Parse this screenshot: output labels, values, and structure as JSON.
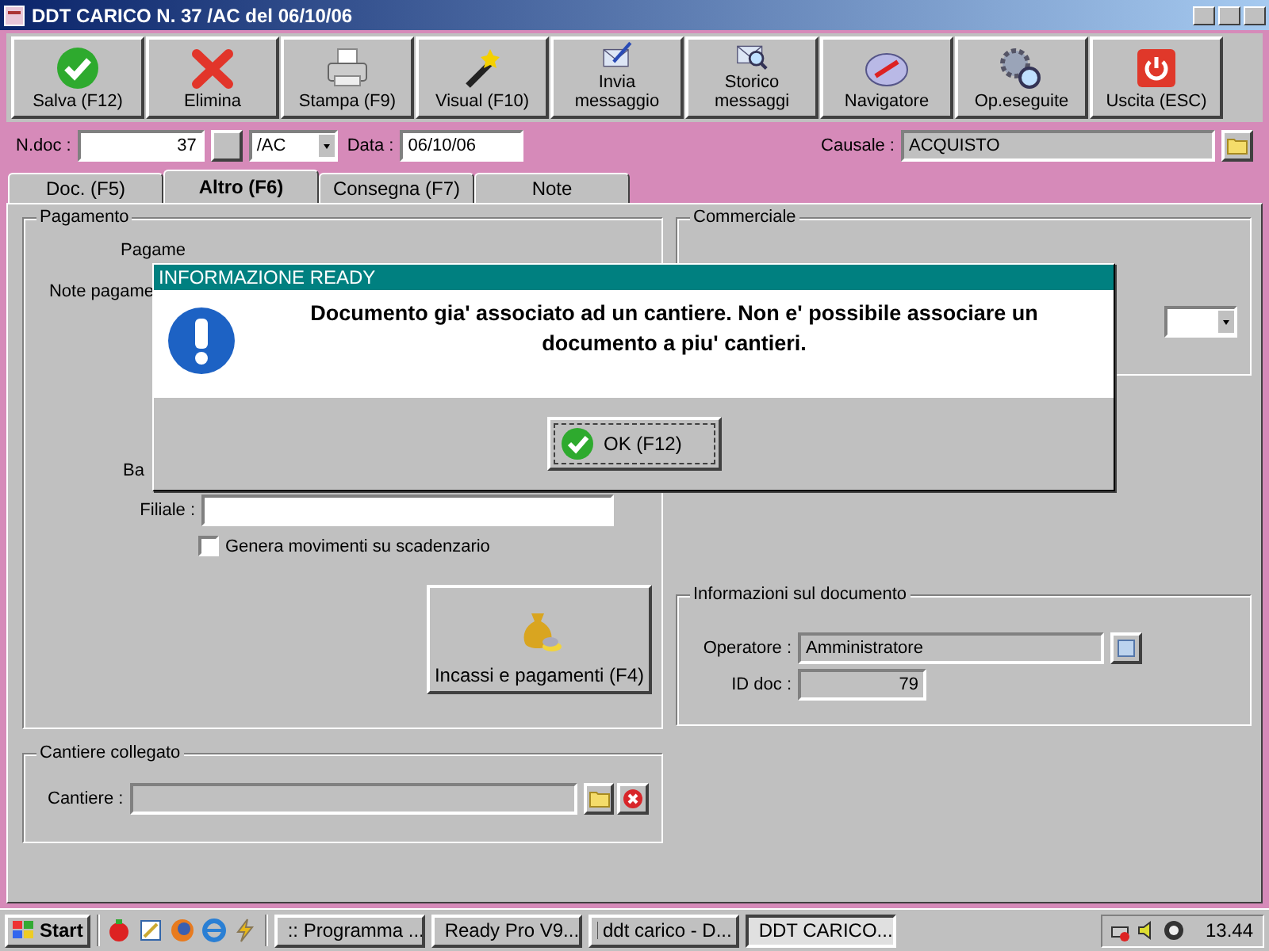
{
  "window": {
    "title": "DDT CARICO N. 37 /AC del 06/10/06"
  },
  "toolbar": [
    {
      "label": "Salva (F12)"
    },
    {
      "label": "Elimina"
    },
    {
      "label": "Stampa (F9)"
    },
    {
      "label": "Visual (F10)"
    },
    {
      "label": "Invia\nmessaggio"
    },
    {
      "label": "Storico\nmessaggi"
    },
    {
      "label": "Navigatore"
    },
    {
      "label": "Op.eseguite"
    },
    {
      "label": "Uscita (ESC)"
    }
  ],
  "header": {
    "ndoc_label": "N.doc :",
    "ndoc_value": "37",
    "series_value": "/AC",
    "data_label": "Data :",
    "data_value": "06/10/06",
    "causale_label": "Causale :",
    "causale_value": "ACQUISTO"
  },
  "tabs": [
    {
      "label": "Doc. (F5)",
      "selected": false
    },
    {
      "label": "Altro (F6)",
      "selected": true
    },
    {
      "label": "Consegna (F7)",
      "selected": false
    },
    {
      "label": "Note",
      "selected": false
    }
  ],
  "pagamento": {
    "title": "Pagamento",
    "pagamento_label": "Pagame",
    "note_label": "Note pagame",
    "banca_label": "Ba",
    "filiale_label": "Filiale :",
    "checkbox": {
      "label": "Genera movimenti su scadenzario",
      "checked": false
    },
    "incassi_button": "Incassi e pagamenti (F4)"
  },
  "cantiere": {
    "title": "Cantiere collegato",
    "label": "Cantiere :"
  },
  "commerciale": {
    "title": "Commerciale"
  },
  "informazioni": {
    "title": "Informazioni sul documento",
    "operatore_label": "Operatore :",
    "operatore_value": "Amministratore",
    "id_label": "ID doc :",
    "id_value": "79"
  },
  "dialog": {
    "title": "INFORMAZIONE READY",
    "message": "Documento gia' associato ad un cantiere. Non e' possibile associare un documento a piu' cantieri.",
    "ok": "OK (F12)"
  },
  "taskbar": {
    "start": "Start",
    "tasks": [
      {
        "label": ":: Programma ...",
        "selected": false
      },
      {
        "label": "Ready Pro V9...",
        "selected": false
      },
      {
        "label": "ddt carico - D...",
        "selected": false
      },
      {
        "label": "DDT CARICO...",
        "selected": true
      }
    ],
    "clock": "13.44"
  }
}
